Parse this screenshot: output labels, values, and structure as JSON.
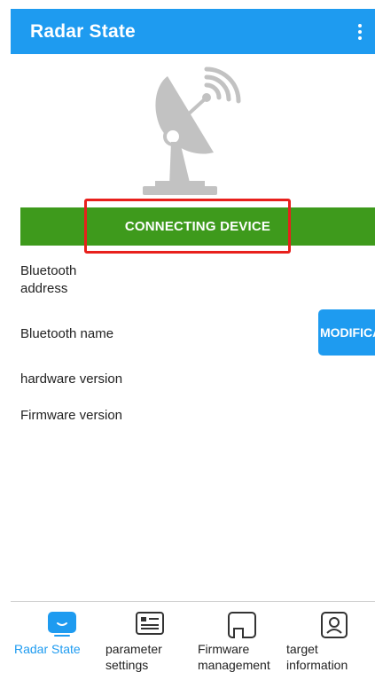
{
  "app_bar": {
    "title": "Radar State",
    "menu_icon": "more-vert-icon"
  },
  "illustration": {
    "icon": "radar-dish-icon",
    "color": "#c2c2c2"
  },
  "connect_button": {
    "label": "CONNECTING DEVICE",
    "color": "#3e9a1c"
  },
  "highlight": {
    "color": "#e8201c"
  },
  "info": {
    "bluetooth_address_label": "Bluetooth address",
    "bluetooth_name_label": "Bluetooth name",
    "hardware_version_label": "hardware version",
    "firmware_version_label": "Firmware version"
  },
  "modify_button": {
    "label": "MODIFICATION"
  },
  "bottom_nav": {
    "active_color": "#1e9bf0",
    "items": [
      {
        "label": "Radar State",
        "icon": "radar-state-icon",
        "active": true
      },
      {
        "label": "parameter settings",
        "icon": "parameter-settings-icon",
        "active": false
      },
      {
        "label": "Firmware management",
        "icon": "firmware-management-icon",
        "active": false
      },
      {
        "label": "target information",
        "icon": "target-information-icon",
        "active": false
      }
    ]
  }
}
